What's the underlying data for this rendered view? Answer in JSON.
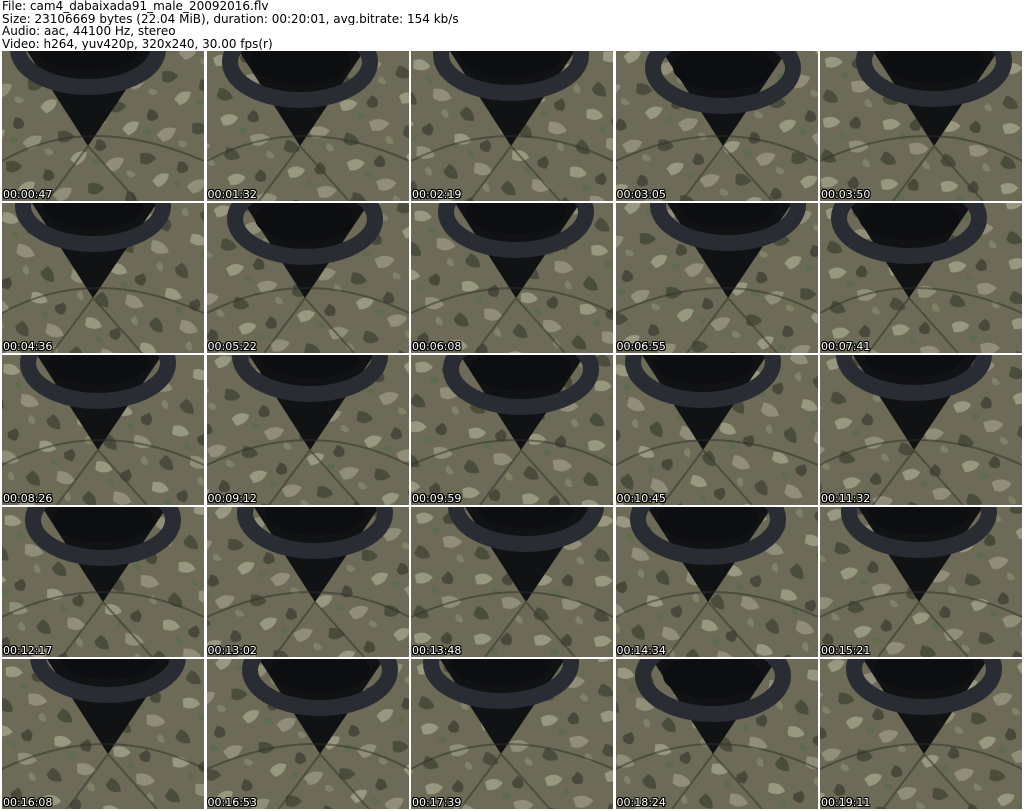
{
  "header": {
    "file_line": "File: cam4_dabaixada91_male_20092016.flv",
    "size_line": "Size: 23106669 bytes (22.04 MiB), duration: 00:20:01, avg.bitrate: 154 kb/s",
    "audio_line": "Audio: aac, 44100 Hz, stereo",
    "video_line": "Video: h264, yuv420p, 320x240, 30.00 fps(r)"
  },
  "thumbnails": [
    {
      "timestamp": "00:00:47"
    },
    {
      "timestamp": "00:01:32"
    },
    {
      "timestamp": "00:02:19"
    },
    {
      "timestamp": "00:03:05"
    },
    {
      "timestamp": "00:03:50"
    },
    {
      "timestamp": "00:04:36"
    },
    {
      "timestamp": "00:05:22"
    },
    {
      "timestamp": "00:06:08"
    },
    {
      "timestamp": "00:06:55"
    },
    {
      "timestamp": "00:07:41"
    },
    {
      "timestamp": "00:08:26"
    },
    {
      "timestamp": "00:09:12"
    },
    {
      "timestamp": "00:09:59"
    },
    {
      "timestamp": "00:10:45"
    },
    {
      "timestamp": "00:11:32"
    },
    {
      "timestamp": "00:12:17"
    },
    {
      "timestamp": "00:13:02"
    },
    {
      "timestamp": "00:13:48"
    },
    {
      "timestamp": "00:14:34"
    },
    {
      "timestamp": "00:15:21"
    },
    {
      "timestamp": "00:16:08"
    },
    {
      "timestamp": "00:16:53"
    },
    {
      "timestamp": "00:17:39"
    },
    {
      "timestamp": "00:18:24"
    },
    {
      "timestamp": "00:19:11"
    }
  ],
  "colors": {
    "camo_base": "#6d6a57",
    "camo_light": "#a7a58d",
    "camo_dark": "#3f4133",
    "wheel": "#2a2c33",
    "dash": "#111214",
    "timestamp_text": "#ffffff"
  }
}
